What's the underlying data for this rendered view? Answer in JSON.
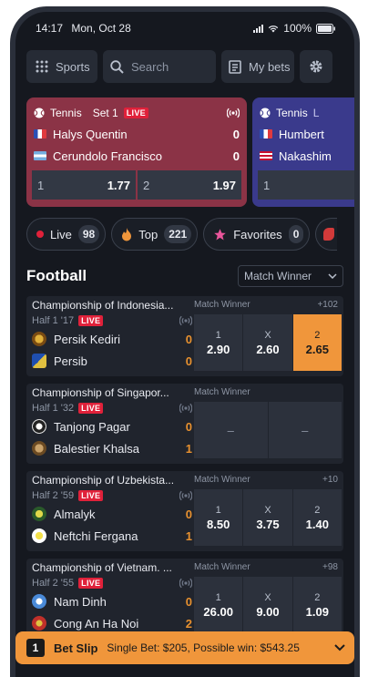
{
  "status": {
    "time": "14:17",
    "date": "Mon, Oct 28",
    "battery": "100%"
  },
  "nav": {
    "sports": "Sports",
    "search_placeholder": "Search",
    "my_bets": "My bets"
  },
  "live_cards": [
    {
      "sport": "Tennis",
      "set": "Set 1",
      "live": "LIVE",
      "players": [
        {
          "name": "Halys Quentin",
          "score": "0"
        },
        {
          "name": "Cerundolo Francisco",
          "score": "0"
        }
      ],
      "odds": [
        {
          "k": "1",
          "v": "1.77"
        },
        {
          "k": "2",
          "v": "1.97"
        }
      ]
    },
    {
      "sport": "Tennis",
      "live": "L",
      "players": [
        {
          "name": "Humbert"
        },
        {
          "name": "Nakashim"
        }
      ],
      "odds": [
        {
          "k": "1"
        }
      ]
    }
  ],
  "chips": [
    {
      "label": "Live",
      "count": "98"
    },
    {
      "label": "Top",
      "count": "221"
    },
    {
      "label": "Favorites",
      "count": "0"
    }
  ],
  "section": {
    "title": "Football",
    "dropdown": "Match Winner"
  },
  "matches": [
    {
      "title": "Championship of Indonesia...",
      "time": "Half 1 '17",
      "live": "LIVE",
      "market": "Match Winner",
      "more": "+102",
      "teams": [
        {
          "name": "Persik Kediri",
          "score": "0"
        },
        {
          "name": "Persib",
          "score": "0"
        }
      ],
      "odds": [
        {
          "k": "1",
          "v": "2.90"
        },
        {
          "k": "X",
          "v": "2.60"
        },
        {
          "k": "2",
          "v": "2.65"
        }
      ],
      "selected": 2
    },
    {
      "title": "Championship of Singapor...",
      "time": "Half 1 '32",
      "live": "LIVE",
      "market": "Match Winner",
      "more": "",
      "teams": [
        {
          "name": "Tanjong Pagar",
          "score": "0"
        },
        {
          "name": "Balestier Khalsa",
          "score": "1"
        }
      ],
      "odds": [
        {
          "k": "–",
          "v": ""
        },
        {
          "k": "–",
          "v": ""
        }
      ],
      "selected": -1
    },
    {
      "title": "Championship of Uzbekista...",
      "time": "Half 2 '59",
      "live": "LIVE",
      "market": "Match Winner",
      "more": "+10",
      "teams": [
        {
          "name": "Almalyk",
          "score": "0"
        },
        {
          "name": "Neftchi Fergana",
          "score": "1"
        }
      ],
      "odds": [
        {
          "k": "1",
          "v": "8.50"
        },
        {
          "k": "X",
          "v": "3.75"
        },
        {
          "k": "2",
          "v": "1.40"
        }
      ],
      "selected": -1
    },
    {
      "title": "Championship of Vietnam. ...",
      "time": "Half 2 '55",
      "live": "LIVE",
      "market": "Match Winner",
      "more": "+98",
      "teams": [
        {
          "name": "Nam Dinh",
          "score": "0"
        },
        {
          "name": "Cong An Ha Noi",
          "score": "2"
        }
      ],
      "odds": [
        {
          "k": "1",
          "v": "26.00"
        },
        {
          "k": "X",
          "v": "9.00"
        },
        {
          "k": "2",
          "v": "1.09"
        }
      ],
      "selected": -1
    }
  ],
  "betslip": {
    "count": "1",
    "title": "Bet Slip",
    "info": "Single Bet: $205, Possible win: $543.25"
  },
  "colors": {
    "accent": "#f0963b",
    "live": "#e0213a",
    "card1": "#8b3346",
    "card2": "#3a3a8c"
  }
}
